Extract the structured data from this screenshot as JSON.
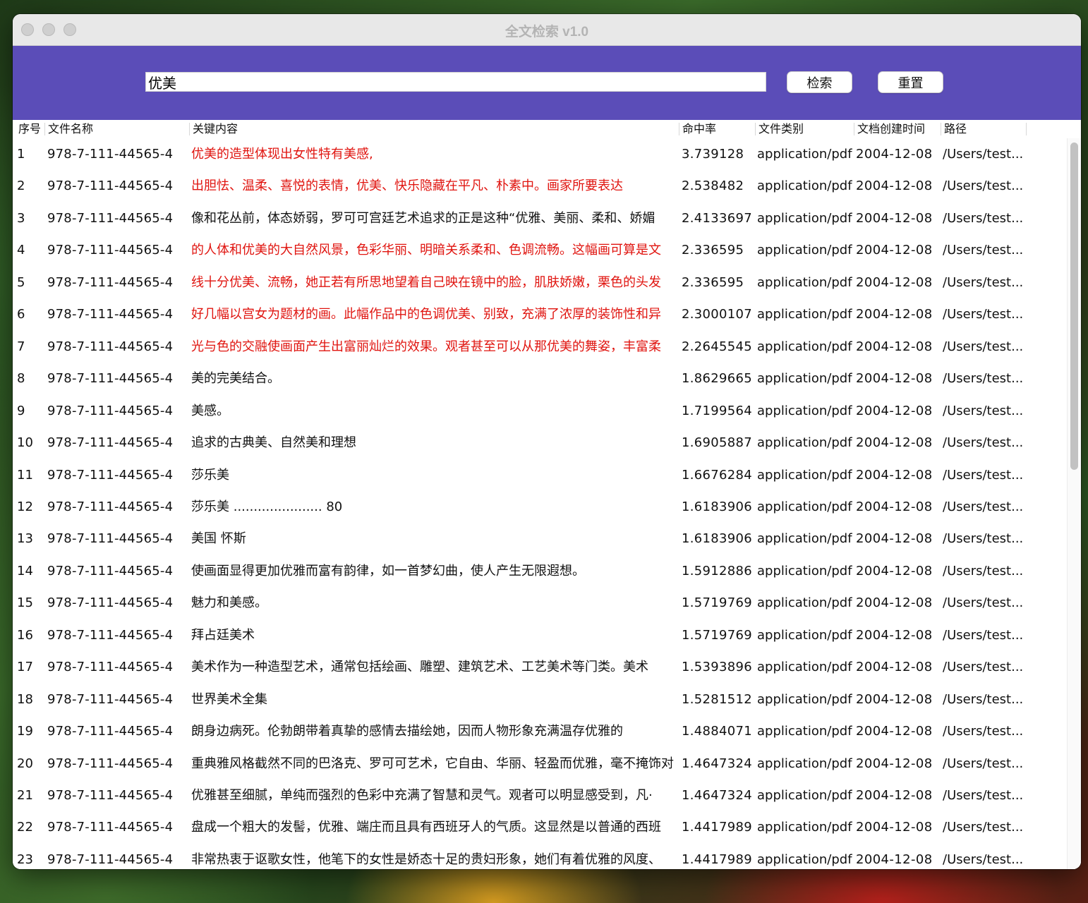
{
  "window": {
    "title": "全文检索 v1.0"
  },
  "search": {
    "value": "优美",
    "search_label": "检索",
    "reset_label": "重置"
  },
  "table": {
    "headers": [
      "序号",
      "文件名称",
      "关键内容",
      "命中率",
      "文件类别",
      "文档创建时间",
      "路径"
    ],
    "rows": [
      {
        "idx": "1",
        "file": "978-7-111-44565-4",
        "key": "优美的造型体现出女性特有美感,",
        "rate": "3.739128",
        "type": "application/pdf",
        "date": "2004-12-08",
        "path": "/Users/test...",
        "hl": true
      },
      {
        "idx": "2",
        "file": "978-7-111-44565-4",
        "key": "出胆怯、温柔、喜悦的表情，优美、快乐隐藏在平凡、朴素中。画家所要表达",
        "rate": "2.538482",
        "type": "application/pdf",
        "date": "2004-12-08",
        "path": "/Users/test...",
        "hl": true
      },
      {
        "idx": "3",
        "file": "978-7-111-44565-4",
        "key": "像和花丛前，体态娇弱，罗可可宫廷艺术追求的正是这种“优雅、美丽、柔和、娇媚",
        "rate": "2.4133697",
        "type": "application/pdf",
        "date": "2004-12-08",
        "path": "/Users/test...",
        "hl": false
      },
      {
        "idx": "4",
        "file": "978-7-111-44565-4",
        "key": "的人体和优美的大自然风景，色彩华丽、明暗关系柔和、色调流畅。这幅画可算是文",
        "rate": "2.336595",
        "type": "application/pdf",
        "date": "2004-12-08",
        "path": "/Users/test...",
        "hl": true
      },
      {
        "idx": "5",
        "file": "978-7-111-44565-4",
        "key": "线十分优美、流畅，她正若有所思地望着自己映在镜中的脸，肌肤娇嫩，栗色的头发",
        "rate": "2.336595",
        "type": "application/pdf",
        "date": "2004-12-08",
        "path": "/Users/test...",
        "hl": true
      },
      {
        "idx": "6",
        "file": "978-7-111-44565-4",
        "key": "好几幅以宫女为题材的画。此幅作品中的色调优美、别致，充满了浓厚的装饰性和异",
        "rate": "2.3000107",
        "type": "application/pdf",
        "date": "2004-12-08",
        "path": "/Users/test...",
        "hl": true
      },
      {
        "idx": "7",
        "file": "978-7-111-44565-4",
        "key": "光与色的交融使画面产生出富丽灿烂的效果。观者甚至可以从那优美的舞姿，丰富柔",
        "rate": "2.2645545",
        "type": "application/pdf",
        "date": "2004-12-08",
        "path": "/Users/test...",
        "hl": true
      },
      {
        "idx": "8",
        "file": "978-7-111-44565-4",
        "key": "美的完美结合。",
        "rate": "1.8629665",
        "type": "application/pdf",
        "date": "2004-12-08",
        "path": "/Users/test...",
        "hl": false
      },
      {
        "idx": "9",
        "file": "978-7-111-44565-4",
        "key": "美感。",
        "rate": "1.7199564",
        "type": "application/pdf",
        "date": "2004-12-08",
        "path": "/Users/test...",
        "hl": false
      },
      {
        "idx": "10",
        "file": "978-7-111-44565-4",
        "key": "追求的古典美、自然美和理想",
        "rate": "1.6905887",
        "type": "application/pdf",
        "date": "2004-12-08",
        "path": "/Users/test...",
        "hl": false
      },
      {
        "idx": "11",
        "file": "978-7-111-44565-4",
        "key": "莎乐美",
        "rate": "1.6676284",
        "type": "application/pdf",
        "date": "2004-12-08",
        "path": "/Users/test...",
        "hl": false
      },
      {
        "idx": "12",
        "file": "978-7-111-44565-4",
        "key": "莎乐美 ...................... 80",
        "rate": "1.6183906",
        "type": "application/pdf",
        "date": "2004-12-08",
        "path": "/Users/test...",
        "hl": false
      },
      {
        "idx": "13",
        "file": "978-7-111-44565-4",
        "key": "美国 怀斯",
        "rate": "1.6183906",
        "type": "application/pdf",
        "date": "2004-12-08",
        "path": "/Users/test...",
        "hl": false
      },
      {
        "idx": "14",
        "file": "978-7-111-44565-4",
        "key": "使画面显得更加优雅而富有韵律，如一首梦幻曲，使人产生无限遐想。",
        "rate": "1.5912886",
        "type": "application/pdf",
        "date": "2004-12-08",
        "path": "/Users/test...",
        "hl": false
      },
      {
        "idx": "15",
        "file": "978-7-111-44565-4",
        "key": "魅力和美感。",
        "rate": "1.5719769",
        "type": "application/pdf",
        "date": "2004-12-08",
        "path": "/Users/test...",
        "hl": false
      },
      {
        "idx": "16",
        "file": "978-7-111-44565-4",
        "key": "拜占廷美术",
        "rate": "1.5719769",
        "type": "application/pdf",
        "date": "2004-12-08",
        "path": "/Users/test...",
        "hl": false
      },
      {
        "idx": "17",
        "file": "978-7-111-44565-4",
        "key": "美术作为一种造型艺术，通常包括绘画、雕塑、建筑艺术、工艺美术等门类。美术",
        "rate": "1.5393896",
        "type": "application/pdf",
        "date": "2004-12-08",
        "path": "/Users/test...",
        "hl": false
      },
      {
        "idx": "18",
        "file": "978-7-111-44565-4",
        "key": "世界美术全集",
        "rate": "1.5281512",
        "type": "application/pdf",
        "date": "2004-12-08",
        "path": "/Users/test...",
        "hl": false
      },
      {
        "idx": "19",
        "file": "978-7-111-44565-4",
        "key": "朗身边病死。伦勃朗带着真挚的感情去描绘她，因而人物形象充满温存优雅的",
        "rate": "1.4884071",
        "type": "application/pdf",
        "date": "2004-12-08",
        "path": "/Users/test...",
        "hl": false
      },
      {
        "idx": "20",
        "file": "978-7-111-44565-4",
        "key": "重典雅风格截然不同的巴洛克、罗可可艺术，它自由、华丽、轻盈而优雅，毫不掩饰对",
        "rate": "1.4647324",
        "type": "application/pdf",
        "date": "2004-12-08",
        "path": "/Users/test...",
        "hl": false
      },
      {
        "idx": "21",
        "file": "978-7-111-44565-4",
        "key": "优雅甚至细腻，单纯而强烈的色彩中充满了智慧和灵气。观者可以明显感受到，凡·",
        "rate": "1.4647324",
        "type": "application/pdf",
        "date": "2004-12-08",
        "path": "/Users/test...",
        "hl": false
      },
      {
        "idx": "22",
        "file": "978-7-111-44565-4",
        "key": "盘成一个粗大的发髻，优雅、端庄而且具有西班牙人的气质。这显然是以普通的西班",
        "rate": "1.4417989",
        "type": "application/pdf",
        "date": "2004-12-08",
        "path": "/Users/test...",
        "hl": false
      },
      {
        "idx": "23",
        "file": "978-7-111-44565-4",
        "key": "非常热衷于讴歌女性，他笔下的女性是娇态十足的贵妇形象，她们有着优雅的风度、",
        "rate": "1.4417989",
        "type": "application/pdf",
        "date": "2004-12-08",
        "path": "/Users/test...",
        "hl": false
      }
    ]
  },
  "colors": {
    "accent": "#5b4db8",
    "highlight": "#e0140f"
  }
}
